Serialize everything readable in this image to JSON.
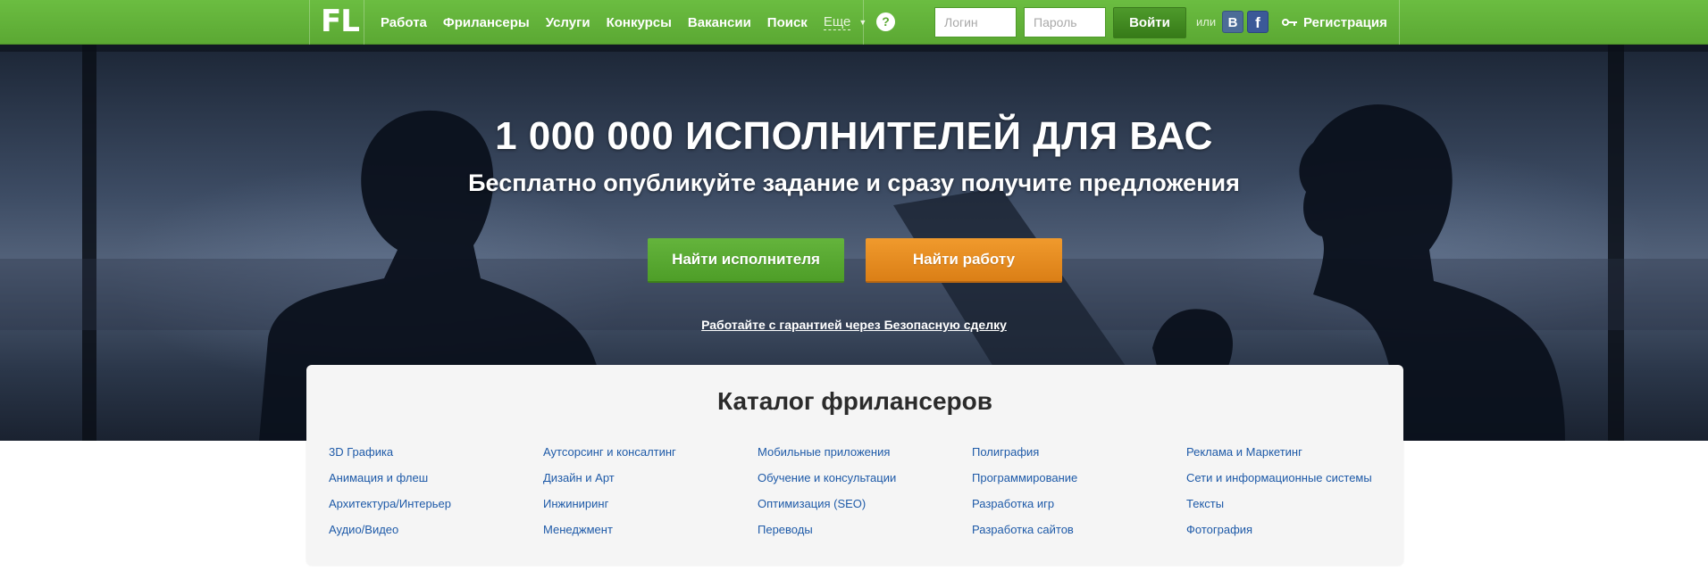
{
  "header": {
    "logo_text": "FL",
    "nav": [
      "Работа",
      "Фрилансеры",
      "Услуги",
      "Конкурсы",
      "Вакансии",
      "Поиск"
    ],
    "more_label": "Еще",
    "help_symbol": "?",
    "login_placeholder": "Логин",
    "password_placeholder": "Пароль",
    "login_button": "Войти",
    "or_text": "или",
    "vk_label": "В",
    "fb_label": "f",
    "register_label": "Регистрация"
  },
  "hero": {
    "title": "1 000 000 ИСПОЛНИТЕЛЕЙ ДЛЯ ВАС",
    "subtitle": "Бесплатно опубликуйте задание и сразу получите предложения",
    "find_freelancer_button": "Найти исполнителя",
    "find_work_button": "Найти работу",
    "safe_deal_link": "Работайте с гарантией через Безопасную сделку"
  },
  "catalog": {
    "title": "Каталог фрилансеров",
    "columns": [
      [
        "3D Графика",
        "Анимация и флеш",
        "Архитектура/Интерьер",
        "Аудио/Видео"
      ],
      [
        "Аутсорсинг и консалтинг",
        "Дизайн и Арт",
        "Инжиниринг",
        "Менеджмент"
      ],
      [
        "Мобильные приложения",
        "Обучение и консультации",
        "Оптимизация (SEO)",
        "Переводы"
      ],
      [
        "Полиграфия",
        "Программирование",
        "Разработка игр",
        "Разработка сайтов"
      ],
      [
        "Реклама и Маркетинг",
        "Сети и информационные системы",
        "Тексты",
        "Фотография"
      ]
    ]
  },
  "colors": {
    "header_green": "#5ba833",
    "green_button": "#5aa933",
    "orange_button": "#e38a1f",
    "catalog_link": "#1e5aa8"
  },
  "icons": [
    "help-icon",
    "vk-icon",
    "facebook-icon",
    "key-icon",
    "chevron-down-icon"
  ]
}
